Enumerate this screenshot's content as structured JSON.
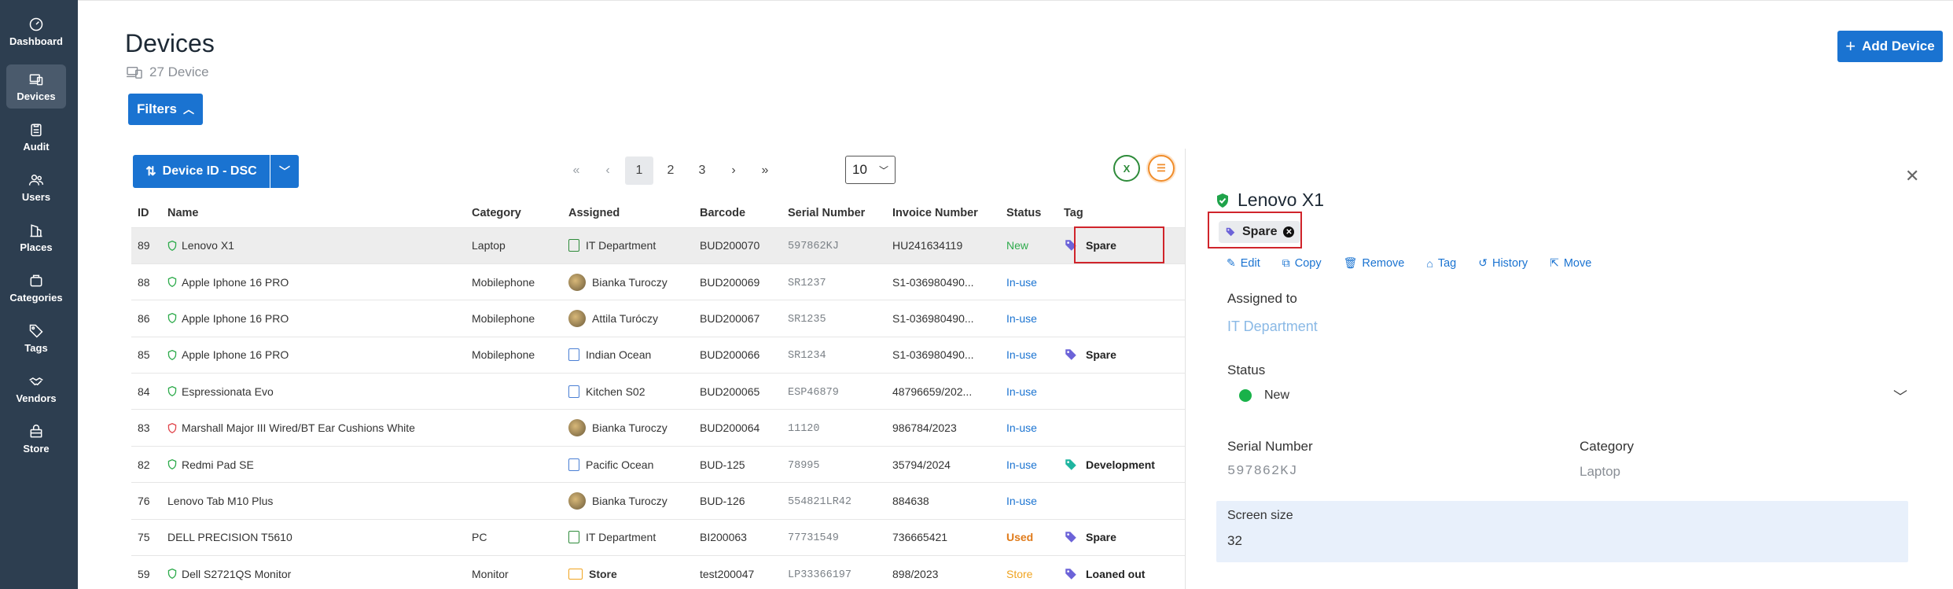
{
  "sidebar": {
    "items": [
      {
        "label": "Dashboard",
        "icon": "dashboard-icon"
      },
      {
        "label": "Devices",
        "icon": "devices-icon"
      },
      {
        "label": "Audit",
        "icon": "clipboard-icon"
      },
      {
        "label": "Users",
        "icon": "users-icon"
      },
      {
        "label": "Places",
        "icon": "building-icon"
      },
      {
        "label": "Categories",
        "icon": "categories-icon"
      },
      {
        "label": "Tags",
        "icon": "tag-icon"
      },
      {
        "label": "Vendors",
        "icon": "handshake-icon"
      },
      {
        "label": "Store",
        "icon": "store-icon"
      }
    ],
    "active": "Devices"
  },
  "header": {
    "title": "Devices",
    "count": "27 Device",
    "filters_label": "Filters",
    "add_label": "Add Device"
  },
  "toolbar": {
    "sort_label": "Device ID - DSC",
    "pages": [
      "1",
      "2",
      "3"
    ],
    "current_page": "1",
    "page_size": "10",
    "excel_icon": "excel-icon",
    "list_icon": "list-icon"
  },
  "table": {
    "columns": [
      "ID",
      "Name",
      "Category",
      "Assigned",
      "Barcode",
      "Serial Number",
      "Invoice Number",
      "Status",
      "Tag"
    ],
    "rows": [
      {
        "id": "89",
        "name": "Lenovo X1",
        "category": "Laptop",
        "assigned": "IT Department",
        "barcode": "BUD200070",
        "serial": "597862KJ",
        "invoice": "HU241634119",
        "status": "New",
        "tag": "Spare"
      },
      {
        "id": "88",
        "name": "Apple Iphone 16 PRO",
        "category": "Mobilephone",
        "assigned": "Bianka Turoczy",
        "barcode": "BUD200069",
        "serial": "SR1237",
        "invoice": "S1-036980490...",
        "status": "In-use",
        "tag": ""
      },
      {
        "id": "86",
        "name": "Apple Iphone 16 PRO",
        "category": "Mobilephone",
        "assigned": "Attila Turóczy",
        "barcode": "BUD200067",
        "serial": "SR1235",
        "invoice": "S1-036980490...",
        "status": "In-use",
        "tag": ""
      },
      {
        "id": "85",
        "name": "Apple Iphone 16 PRO",
        "category": "Mobilephone",
        "assigned": "Indian Ocean",
        "barcode": "BUD200066",
        "serial": "SR1234",
        "invoice": "S1-036980490...",
        "status": "In-use",
        "tag": "Spare"
      },
      {
        "id": "84",
        "name": "Espressionata Evo",
        "category": "",
        "assigned": "Kitchen S02",
        "barcode": "BUD200065",
        "serial": "ESP46879",
        "invoice": "48796659/202...",
        "status": "In-use",
        "tag": ""
      },
      {
        "id": "83",
        "name": "Marshall Major III Wired/BT Ear Cushions White",
        "category": "",
        "assigned": "Bianka Turoczy",
        "barcode": "BUD200064",
        "serial": "11120",
        "invoice": "986784/2023",
        "status": "In-use",
        "tag": ""
      },
      {
        "id": "82",
        "name": "Redmi Pad SE",
        "category": "",
        "assigned": "Pacific Ocean",
        "barcode": "BUD-125",
        "serial": "78995",
        "invoice": "35794/2024",
        "status": "In-use",
        "tag": "Development"
      },
      {
        "id": "76",
        "name": "Lenovo Tab M10 Plus",
        "category": "",
        "assigned": "Bianka Turoczy",
        "barcode": "BUD-126",
        "serial": "554821LR42",
        "invoice": "884638",
        "status": "In-use",
        "tag": ""
      },
      {
        "id": "75",
        "name": "DELL PRECISION T5610",
        "category": "PC",
        "assigned": "IT Department",
        "barcode": "BI200063",
        "serial": "77731549",
        "invoice": "736665421",
        "status": "Used",
        "tag": "Spare"
      },
      {
        "id": "59",
        "name": "Dell S2721QS Monitor",
        "category": "Monitor",
        "assigned": "Store",
        "barcode": "test200047",
        "serial": "LP33366197",
        "invoice": "898/2023",
        "status": "Store",
        "tag": "Loaned out"
      }
    ]
  },
  "detail": {
    "title": "Lenovo X1",
    "tag": "Spare",
    "actions": [
      "Edit",
      "Copy",
      "Remove",
      "Tag",
      "History",
      "Move"
    ],
    "assigned_label": "Assigned to",
    "assigned_value": "IT Department",
    "status_label": "Status",
    "status_value": "New",
    "serial_label": "Serial Number",
    "serial_value": "597862KJ",
    "category_label": "Category",
    "category_value": "Laptop",
    "screen_label": "Screen size",
    "screen_value": "32"
  },
  "colors": {
    "sidebar_bg": "#2d3e50",
    "accent": "#1a73d1",
    "status_new": "#2eab4c",
    "status_used": "#e07b1a",
    "status_store": "#f0a420",
    "highlight": "#d0242b"
  }
}
